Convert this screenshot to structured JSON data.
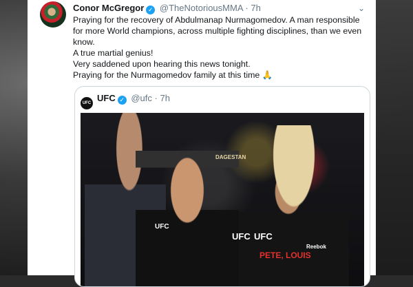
{
  "tweet": {
    "display_name": "Conor McGregor",
    "handle": "@TheNotoriousMMA",
    "separator": "·",
    "time": "7h",
    "text_lines": [
      "Praying for the recovery of Abdulmanap Nurmagomedov. A man responsible for more World champions, across multiple fighting disciplines, than we even know.",
      "A true martial genius!",
      "Very saddened upon hearing this news tonight.",
      "Praying for the Nurmagomedov family at this time"
    ],
    "emoji": "🙏"
  },
  "quoted_tweet": {
    "avatar_label": "UFC",
    "display_name": "UFC",
    "handle": "@ufc",
    "separator": "·",
    "time": "7h",
    "photo_text": {
      "cap_text": "DAGESTAN",
      "ufc_left": "UFC",
      "ufc_mid": "UFC",
      "ufc_right": "UFC",
      "reebok": "Reebok",
      "jersey": "PETE, LOUIS"
    }
  },
  "icons": {
    "verified": "verified-badge-icon",
    "menu": "chevron-down-icon"
  },
  "colors": {
    "verified_blue": "#1da1f2",
    "text_primary": "#14171a",
    "text_secondary": "#657786"
  }
}
